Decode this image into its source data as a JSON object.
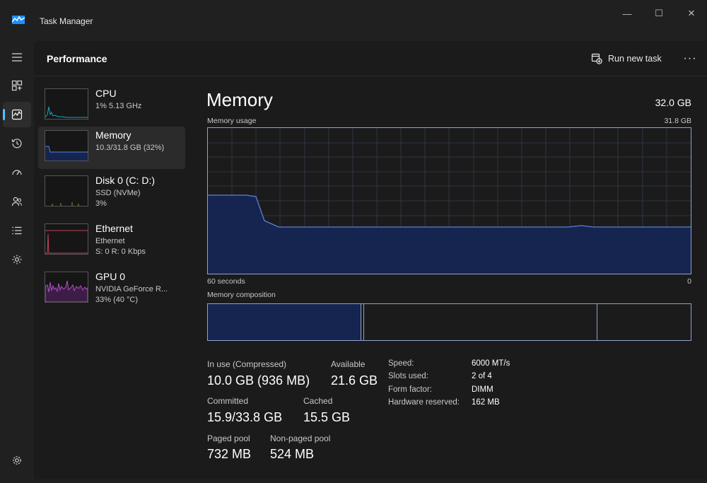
{
  "window": {
    "title": "Task Manager",
    "minimize_glyph": "—",
    "maximize_glyph": "☐",
    "close_glyph": "✕"
  },
  "rail": {
    "icons": [
      "hamburger-icon",
      "processes-icon",
      "performance-icon",
      "app-history-icon",
      "startup-apps-icon",
      "users-icon",
      "details-icon",
      "services-icon",
      "settings-icon"
    ],
    "active": "performance-icon"
  },
  "header": {
    "title": "Performance",
    "run_task_label": "Run new task",
    "more_label": "···"
  },
  "resources": [
    {
      "name": "CPU",
      "line1": "1%  5.13 GHz",
      "line2": "",
      "color": "#17a2c8"
    },
    {
      "name": "Memory",
      "line1": "10.3/31.8 GB (32%)",
      "line2": "",
      "color": "#5b7fd6"
    },
    {
      "name": "Disk 0 (C: D:)",
      "line1": "SSD (NVMe)",
      "line2": "3%",
      "color": "#83a02f"
    },
    {
      "name": "Ethernet",
      "line1": "Ethernet",
      "line2": "S: 0  R: 0 Kbps",
      "color": "#c3435a"
    },
    {
      "name": "GPU 0",
      "line1": "NVIDIA GeForce R...",
      "line2": "33%  (40 °C)",
      "color": "#b44ec7"
    }
  ],
  "detail": {
    "title": "Memory",
    "total": "32.0 GB",
    "usage_label": "Memory usage",
    "usage_max": "31.8 GB",
    "time_span": "60 seconds",
    "zero": "0",
    "composition_label": "Memory composition",
    "usage_percent": 32
  },
  "stats": {
    "in_use_label": "In use (Compressed)",
    "in_use_value": "10.0 GB (936 MB)",
    "available_label": "Available",
    "available_value": "21.6 GB",
    "committed_label": "Committed",
    "committed_value": "15.9/33.8 GB",
    "cached_label": "Cached",
    "cached_value": "15.5 GB",
    "paged_label": "Paged pool",
    "paged_value": "732 MB",
    "nonpaged_label": "Non-paged pool",
    "nonpaged_value": "524 MB"
  },
  "specs": [
    {
      "label": "Speed:",
      "value": "6000 MT/s"
    },
    {
      "label": "Slots used:",
      "value": "2 of 4"
    },
    {
      "label": "Form factor:",
      "value": "DIMM"
    },
    {
      "label": "Hardware reserved:",
      "value": "162 MB"
    }
  ],
  "colors": {
    "accent": "#4cc2ff",
    "memory_line": "#5b7fd6",
    "memory_fill": "#16254f",
    "graph_border": "#8ea3cc"
  }
}
